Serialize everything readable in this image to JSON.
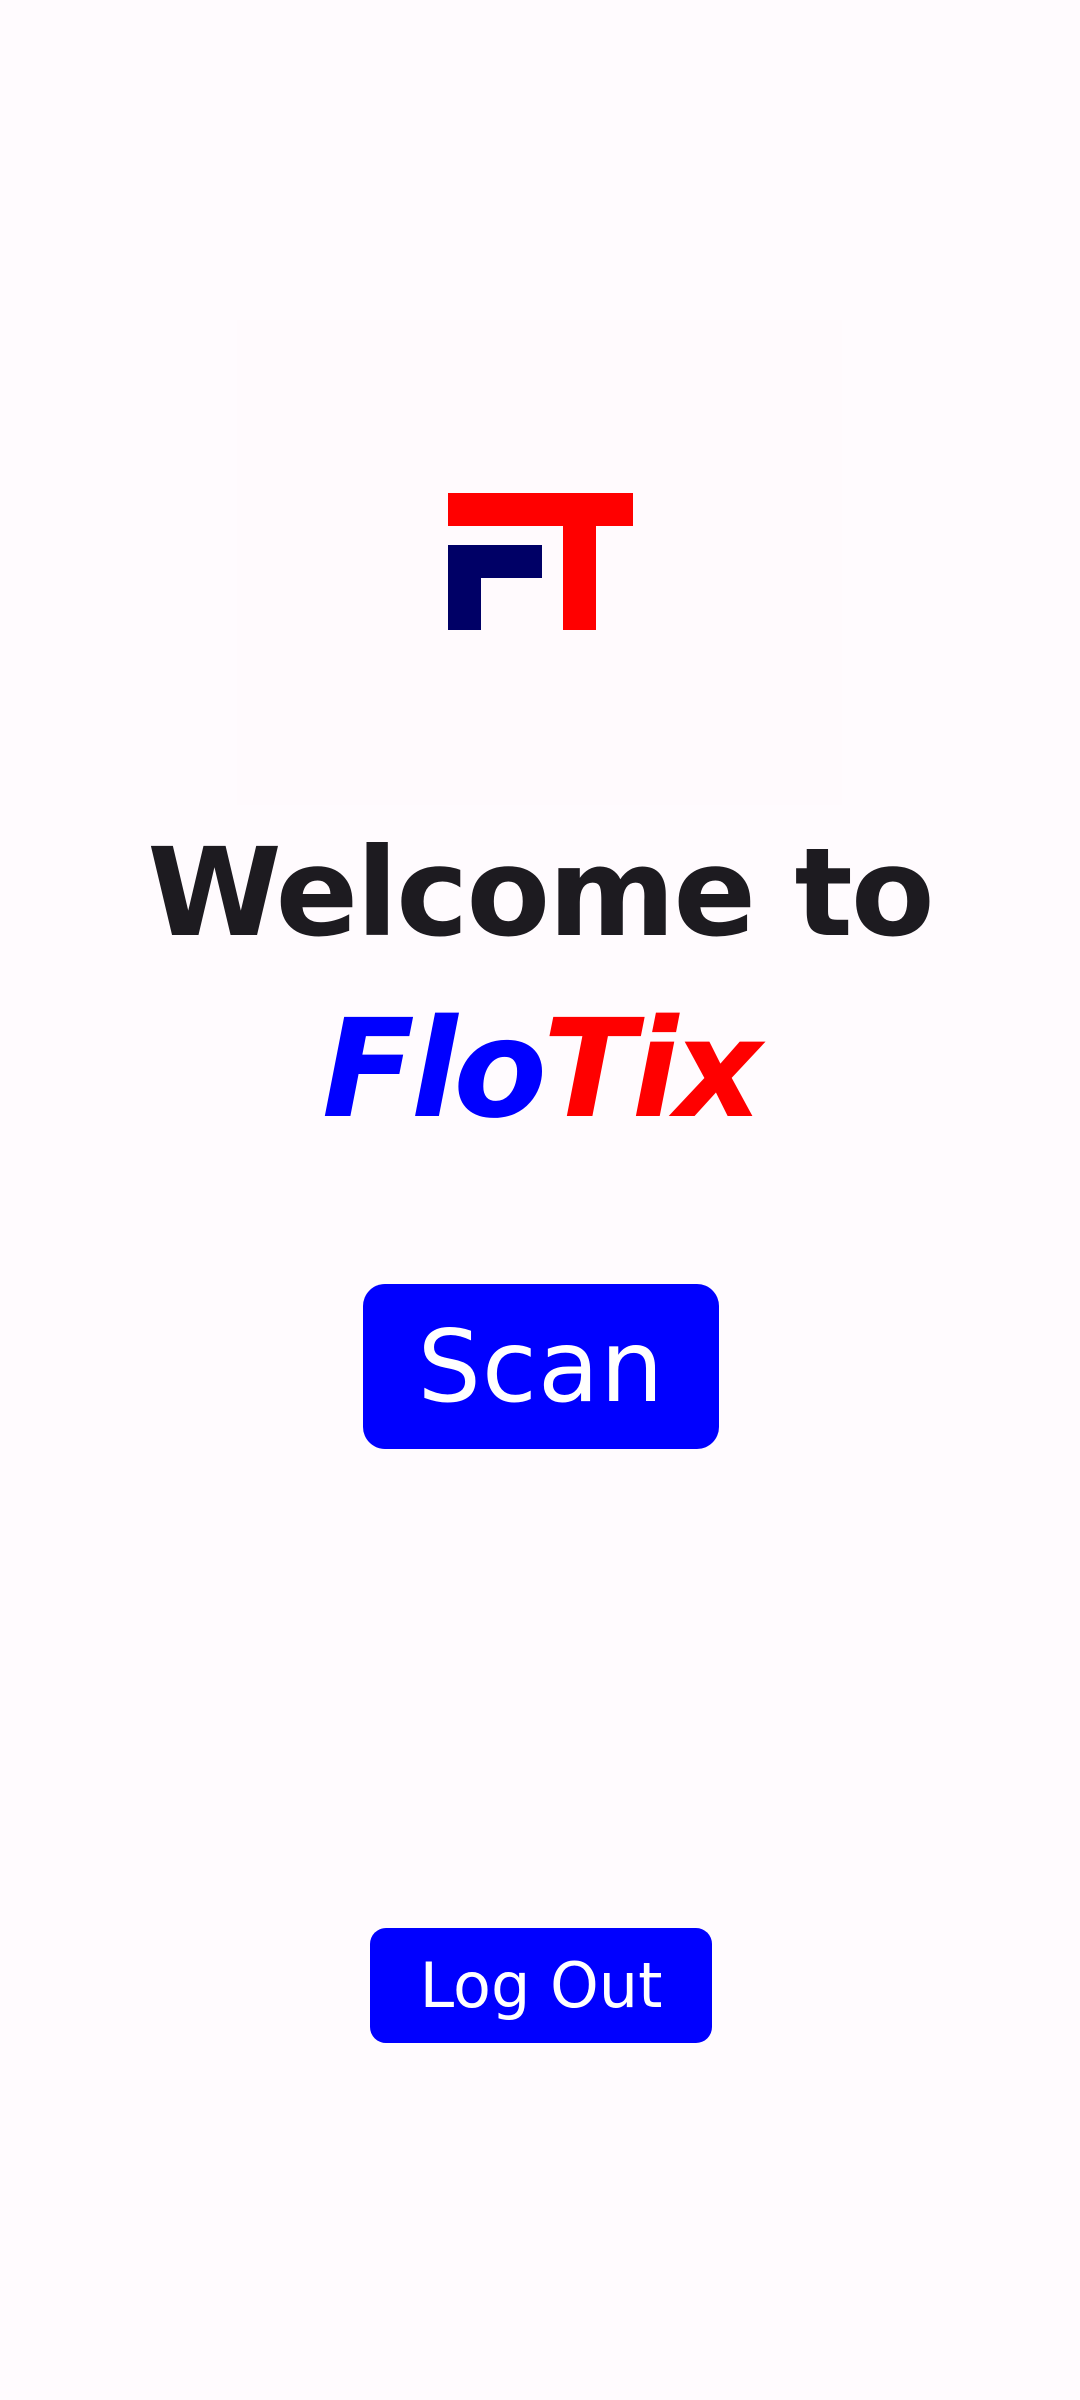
{
  "welcome": {
    "heading": "Welcome to",
    "brand_part1": "Flo",
    "brand_part2": "Tix"
  },
  "actions": {
    "scan_label": "Scan",
    "logout_label": "Log Out"
  },
  "logo": {
    "icon": "flotix-logo-icon",
    "colors": {
      "red": "#ff0000",
      "navy": "#000066"
    }
  },
  "colors": {
    "background": "#fffbfe",
    "accent_blue": "#0000ff",
    "accent_red": "#ff0000",
    "text_dark": "#1d1b20"
  }
}
